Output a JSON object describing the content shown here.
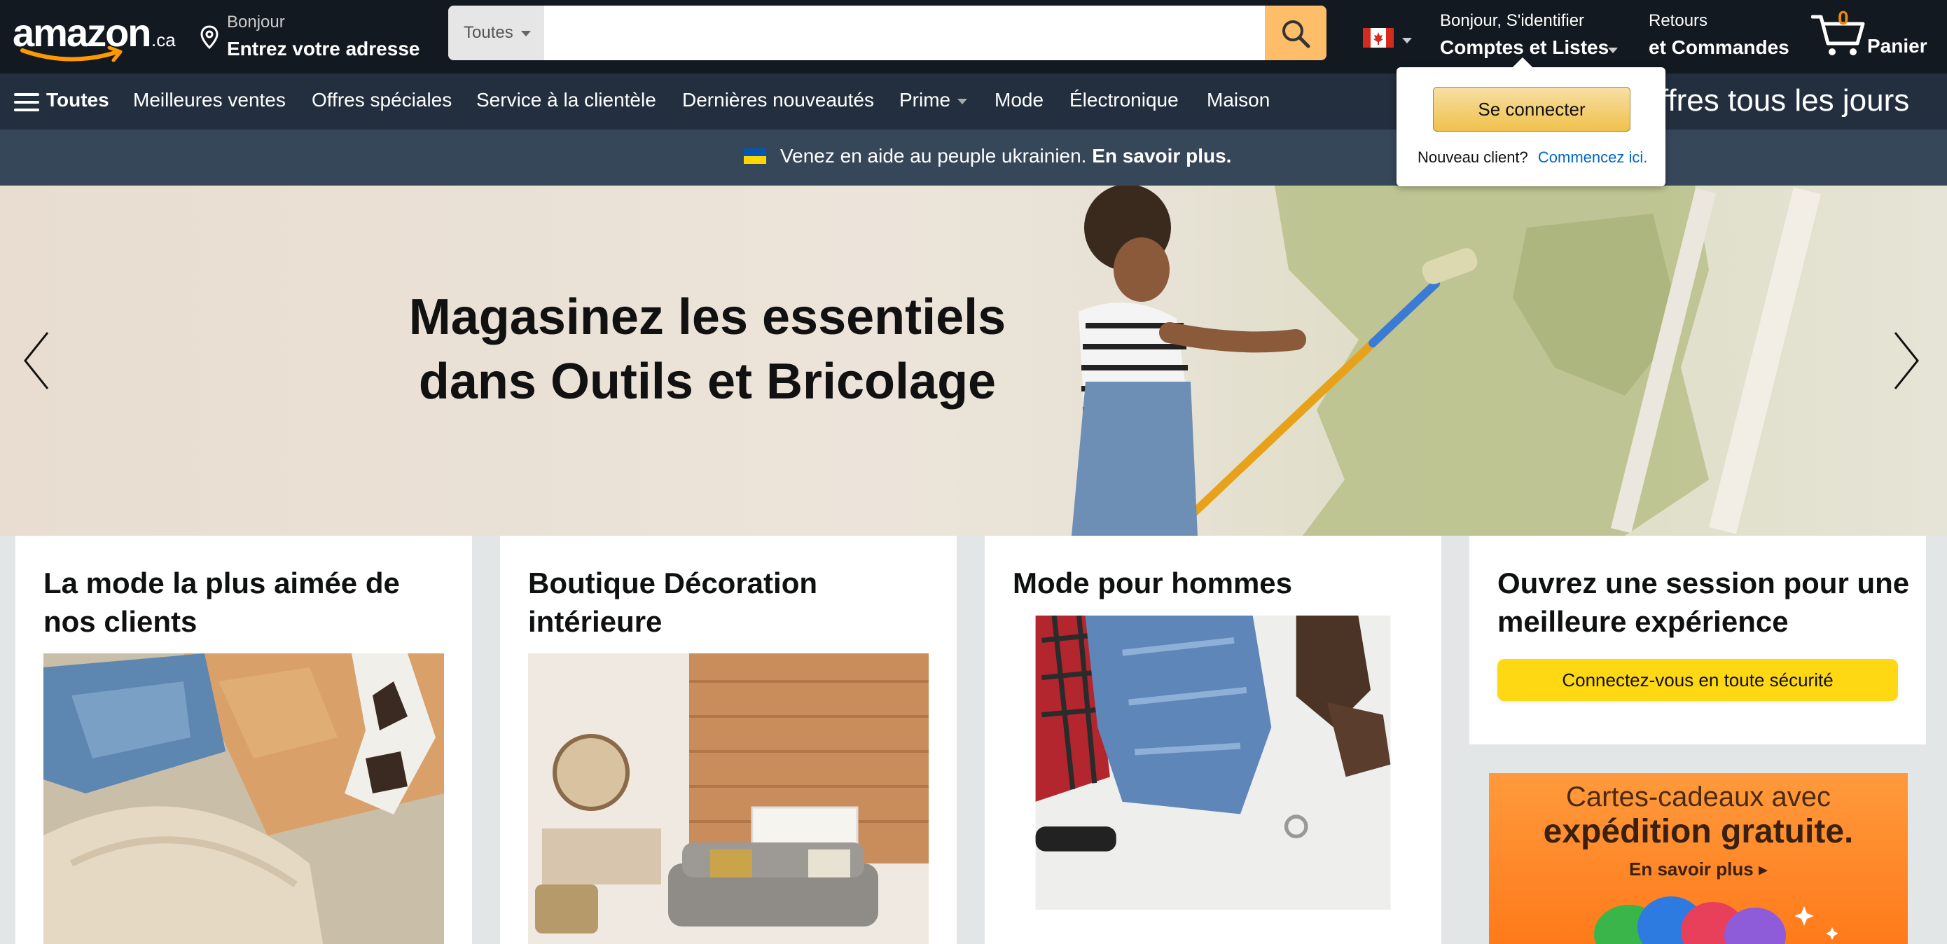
{
  "header": {
    "logo_text": "amazon",
    "logo_tld": ".ca",
    "address_line1": "Bonjour",
    "address_line2": "Entrez votre adresse",
    "search_category": "Toutes",
    "search_value": "",
    "account_line1": "Bonjour, S'identifier",
    "account_line2": "Comptes et Listes",
    "orders_line1": "Retours",
    "orders_line2": "et Commandes",
    "cart_count": "0",
    "cart_label": "Panier"
  },
  "nav": {
    "menu_label": "Toutes",
    "items": [
      "Meilleures ventes",
      "Offres spéciales",
      "Service à la clientèle",
      "Dernières nouveautés",
      "Prime",
      "Mode",
      "Électronique",
      "Maison"
    ],
    "promo": "ffres tous les jours"
  },
  "notice": {
    "text": "Venez en aide au peuple ukrainien.",
    "link": "En savoir plus."
  },
  "hero": {
    "title_line1": "Magasinez les essentiels",
    "title_line2": "dans Outils et Bricolage"
  },
  "cards": [
    {
      "title": "La mode la plus aimée de nos clients"
    },
    {
      "title": "Boutique Décoration intérieure"
    },
    {
      "title": "Mode pour hommes"
    }
  ],
  "signin_card": {
    "title": "Ouvrez une session pour une meilleure expérience",
    "button": "Connectez-vous en toute sécurité"
  },
  "gift_ad": {
    "line1": "Cartes-cadeaux avec",
    "line2": "expédition gratuite.",
    "line3": "En savoir plus ▸"
  },
  "flyout": {
    "button": "Se connecter",
    "new_customer": "Nouveau client?",
    "start_link": "Commencez ici."
  },
  "colors": {
    "header_bg": "#131921",
    "nav_bg": "#232f3e",
    "notice_bg": "#37475a",
    "search_button": "#febd69",
    "accent_yellow": "#ffd814",
    "cart_count": "#f08804",
    "link_blue": "#0066c0"
  }
}
